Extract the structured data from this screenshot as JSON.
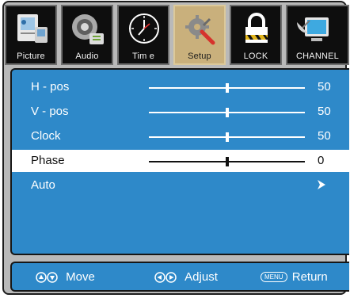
{
  "tabs": [
    {
      "label": "Picture",
      "icon": "picture-icon"
    },
    {
      "label": "Audio",
      "icon": "audio-icon"
    },
    {
      "label": "Tim e",
      "icon": "clock-icon"
    },
    {
      "label": "Setup",
      "icon": "tools-icon",
      "active": true
    },
    {
      "label": "LOCK",
      "icon": "lock-icon"
    },
    {
      "label": "CHANNEL",
      "icon": "satellite-icon"
    }
  ],
  "settings": [
    {
      "label": "H - pos",
      "value": "50",
      "level": 0.5
    },
    {
      "label": "V - pos",
      "value": "50",
      "level": 0.5
    },
    {
      "label": "Clock",
      "value": "50",
      "level": 0.5
    },
    {
      "label": "Phase",
      "value": "0",
      "level": 0.5,
      "selected": true
    },
    {
      "label": "Auto"
    }
  ],
  "footer": {
    "move_label": "Move",
    "adjust_label": "Adjust",
    "menu_key_label": "MENU",
    "return_label": "Return"
  },
  "colors": {
    "panel": "#2e89c9",
    "active_tab": "#c9b07c",
    "selected_row": "#ffffff"
  }
}
